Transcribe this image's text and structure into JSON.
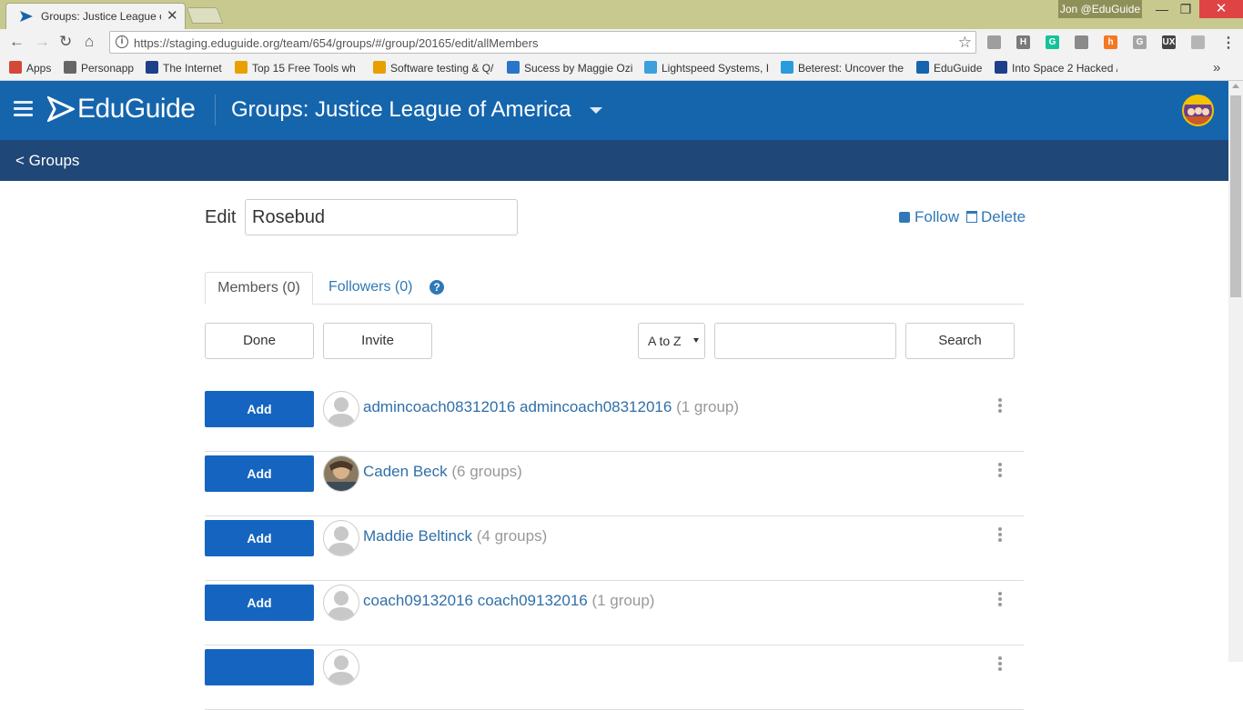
{
  "browser": {
    "tab_title": "Groups: Justice League of",
    "tab_close": "✕",
    "profile_name": "Jon @EduGuide",
    "url": "https://staging.eduguide.org/team/654/groups/#/group/20165/edit/allMembers",
    "bookmarks": [
      {
        "label": "Apps",
        "color": "#d34836"
      },
      {
        "label": "Personapp",
        "color": "#666666"
      },
      {
        "label": "The Internet",
        "color": "#1e3f8a"
      },
      {
        "label": "Top 15 Free Tools wh",
        "color": "#e8a000"
      },
      {
        "label": "Software testing & Q/",
        "color": "#e8a000"
      },
      {
        "label": "Sucess by Maggie Ozi",
        "color": "#2a75c9"
      },
      {
        "label": "Lightspeed Systems, I",
        "color": "#3ca0dc"
      },
      {
        "label": "Beterest: Uncover the",
        "color": "#2a9bdc"
      },
      {
        "label": "EduGuide",
        "color": "#1565ad"
      },
      {
        "label": "Into Space 2 Hacked /",
        "color": "#1e3f8a"
      }
    ],
    "extensions": [
      {
        "name": "globe-ext-icon",
        "color": "#9e9e9e",
        "glyph": ""
      },
      {
        "name": "h-ext-icon",
        "color": "#7a7a7a",
        "glyph": "H"
      },
      {
        "name": "grammarly-ext-icon",
        "color": "#15c39a",
        "glyph": "G"
      },
      {
        "name": "camera-ext-icon",
        "color": "#8a8a8a",
        "glyph": ""
      },
      {
        "name": "hubspot-ext-icon",
        "color": "#f57722",
        "glyph": "h"
      },
      {
        "name": "g-ext-icon",
        "color": "#a5a5a5",
        "glyph": "G"
      },
      {
        "name": "ux-ext-icon",
        "color": "#444444",
        "glyph": "UX"
      },
      {
        "name": "circle-ext-icon",
        "color": "#b5b5b5",
        "glyph": ""
      }
    ]
  },
  "app": {
    "logo_text": "EduGuide",
    "group_title": "Groups: Justice League of America",
    "back_link": "< Groups",
    "brand_color": "#1565ad",
    "subbar_color": "#1f4777"
  },
  "edit": {
    "label": "Edit",
    "name_value": "Rosebud",
    "follow_label": "Follow",
    "delete_label": "Delete"
  },
  "tabs": {
    "members": "Members (0)",
    "followers": "Followers (0)",
    "help": "?"
  },
  "actions": {
    "done": "Done",
    "invite": "Invite",
    "sort_value": "A to Z",
    "search": "Search"
  },
  "members": [
    {
      "name": "admincoach08312016 admincoach08312016",
      "count": "(1 group)",
      "add": "Add",
      "photo": false
    },
    {
      "name": "Caden Beck",
      "count": "(6 groups)",
      "add": "Add",
      "photo": true
    },
    {
      "name": "Maddie Beltinck",
      "count": "(4 groups)",
      "add": "Add",
      "photo": false
    },
    {
      "name": "coach09132016 coach09132016",
      "count": "(1 group)",
      "add": "Add",
      "photo": false
    },
    {
      "name": "",
      "count": "",
      "add": "",
      "photo": false
    }
  ]
}
